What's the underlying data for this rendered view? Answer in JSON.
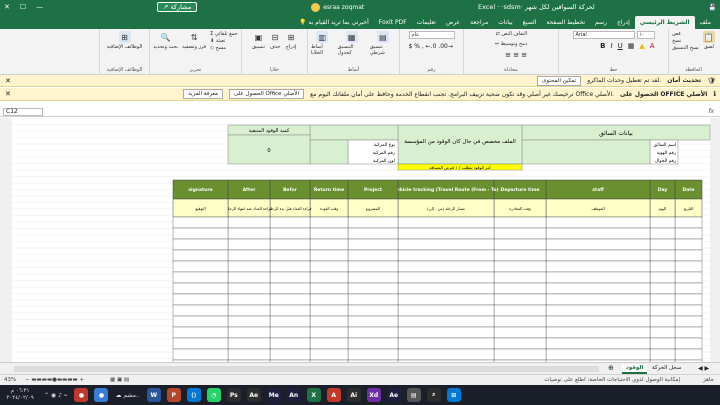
{
  "titlebar": {
    "title": "Excel · ·sdsm· لحركة السواقين لكل شهر",
    "user": "esraa zoqmat",
    "share": "مشاركة",
    "search": "أخبرني بما تريد القيام به"
  },
  "tabs": [
    "ملف",
    "الشريط الرئيسي",
    "إدراج",
    "رسم",
    "تخطيط الصفحة",
    "الصيغ",
    "بيانات",
    "مراجعة",
    "عرض",
    "تعليمات",
    "Foxit PDF"
  ],
  "ribbon": {
    "clipboard": {
      "name": "الحافظة",
      "paste": "لصق",
      "cut": "قص",
      "copy": "نسخ",
      "painter": "نسخ التنسيق"
    },
    "font": {
      "name": "خط",
      "family": "Arial",
      "size": "١٠"
    },
    "align": {
      "name": "محاذاة",
      "wrap": "التفاف النص",
      "merge": "دمج وتوسيط"
    },
    "number": {
      "name": "رقم",
      "format": "عام"
    },
    "styles": {
      "name": "أنماط",
      "cond": "تنسيق شرطي",
      "table": "التنسيق كجدول",
      "cell": "أنماط الخلايا"
    },
    "cells": {
      "name": "خلايا",
      "insert": "إدراج",
      "delete": "حذف",
      "format": "تنسيق"
    },
    "editing": {
      "name": "تحرير",
      "sum": "جمع تلقائي",
      "fill": "تعبئة",
      "clear": "مسح",
      "sort": "فرز وتصفية",
      "find": "بحث وتحديد"
    },
    "addins": {
      "name": "الوظائف الإضافية",
      "label": "الوظائف الإضافية"
    }
  },
  "msg1": {
    "title": "تحديث أمان",
    "text": "لقد تم تعطيل وحدات الماكرو.",
    "button": "تمكين المحتوى"
  },
  "msg2": {
    "title": "الحصول على OFFICE الأصلي",
    "text": "ترخيصك غير أصلي وقد تكون ضحية تزييف البرامج. تجنب انقطاع الخدمة وحافظ على أمان ملفاتك اليوم مع Office الأصلي.",
    "button": "الحصول على Office الأصلي",
    "more": "معرفة المزيد"
  },
  "formula": {
    "cell": "C12",
    "fx": "fx"
  },
  "sheet": {
    "driver_header": "بيانات السائق",
    "driver_fields": [
      "اسم السائق",
      "رقم الهوية",
      "رقم الجوال"
    ],
    "mid_title": "الملف مخصص في حال كان الوقود من المؤسسة",
    "vehicle_fields": [
      "نوع المركبة",
      "رقم المركبة",
      "لون المركبة"
    ],
    "fuel_title": "كمية الوقود المتبقية",
    "fuel_value": "0",
    "fuel_note": "أمر الوقود يتطلب / ١ لغرض المسافة",
    "columns": [
      "Date",
      "Day",
      "staff",
      "Departure time",
      "Vehicle tracking (Travel Route (From - To)",
      "Project",
      "Return time",
      "Befor",
      "After",
      "signature"
    ],
    "sub": [
      "التاريخ",
      "اليوم",
      "الموظف",
      "وقت المغادرة",
      "مسار الرحلة (من - إلى)",
      "المشروع",
      "وقت العودة",
      "قراءة العداد قبل بدء الرحلة",
      "قراءة العداد عند انتهاء الرحلة",
      "التوقيع"
    ]
  },
  "sheettabs": {
    "active": "الوقود",
    "other": "سجل الحركة"
  },
  "status": {
    "left": "جاهز",
    "accessibility": "إمكانية الوصول لذوي الاحتياجات الخاصة: اطلع على توصيات",
    "zoom": "43%"
  },
  "taskbar": {
    "time": "٠٦:٣١ م",
    "date": "٢٠٢٤/٠٢/٠٩",
    "search": "بحث"
  }
}
